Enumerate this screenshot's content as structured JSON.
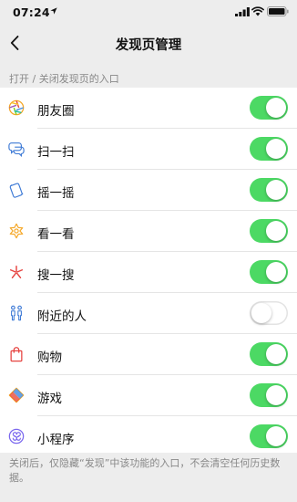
{
  "status_bar": {
    "time": "07:24",
    "location_icon": "location-arrow-icon",
    "signal_icon": "cellular-signal-icon",
    "wifi_icon": "wifi-icon",
    "battery_icon": "battery-icon"
  },
  "nav": {
    "title": "发现页管理",
    "back_icon": "chevron-left-icon"
  },
  "section_header": "打开 / 关闭发现页的入口",
  "items": [
    {
      "label": "朋友圈",
      "icon": "moments-icon",
      "enabled": true
    },
    {
      "label": "扫一扫",
      "icon": "scan-icon",
      "enabled": true
    },
    {
      "label": "摇一摇",
      "icon": "shake-icon",
      "enabled": true
    },
    {
      "label": "看一看",
      "icon": "top-stories-icon",
      "enabled": true
    },
    {
      "label": "搜一搜",
      "icon": "search-icon",
      "enabled": true
    },
    {
      "label": "附近的人",
      "icon": "people-nearby-icon",
      "enabled": false
    },
    {
      "label": "购物",
      "icon": "shopping-bag-icon",
      "enabled": true
    },
    {
      "label": "游戏",
      "icon": "games-icon",
      "enabled": true
    },
    {
      "label": "小程序",
      "icon": "mini-programs-icon",
      "enabled": true
    }
  ],
  "footnote": "关闭后，仅隐藏“发现”中该功能的入口，不会清空任何历史数据。",
  "colors": {
    "toggle_on": "#4cd964",
    "background": "#ededed",
    "secondary_text": "#888888"
  }
}
